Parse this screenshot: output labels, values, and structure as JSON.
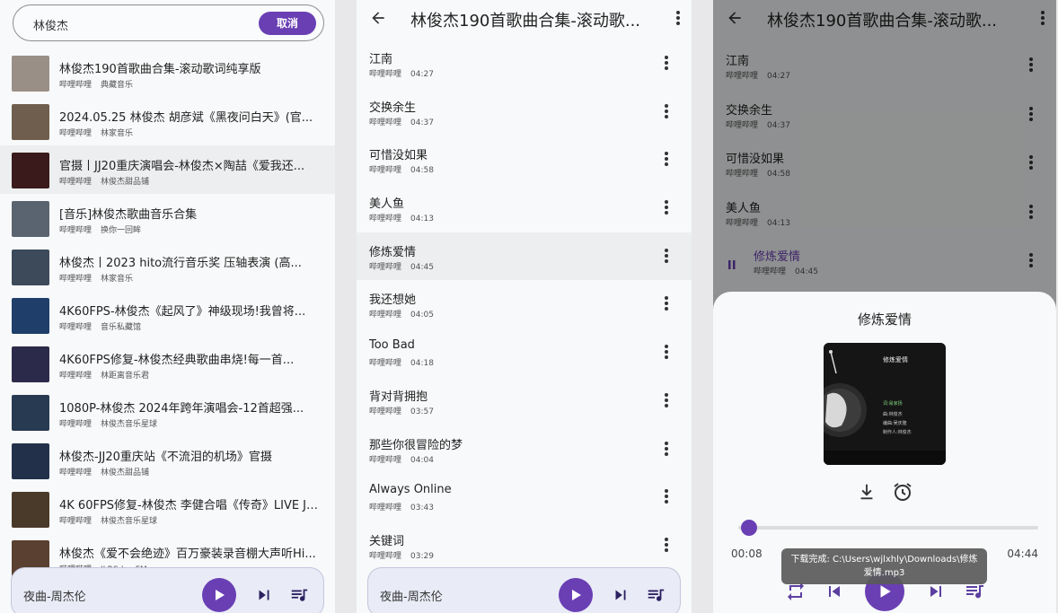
{
  "search": {
    "query": "林俊杰",
    "cancel_label": "取消"
  },
  "results": [
    {
      "title": "林俊杰190首歌曲合集-滚动歌词纯享版",
      "source": "哔哩哔哩",
      "uploader": "典藏音乐",
      "thumb_color": "#9a8f86"
    },
    {
      "title": "2024.05.25 林俊杰 胡彦斌《黑夜问白天》(官...",
      "source": "哔哩哔哩",
      "uploader": "林家音乐",
      "thumb_color": "#6f5e4d"
    },
    {
      "title": "官摄丨JJ20重庆演唱会-林俊杰×陶喆《爱我还...",
      "source": "哔哩哔哩",
      "uploader": "林俊杰甜品铺",
      "thumb_color": "#3a1a1a"
    },
    {
      "title": "[音乐]林俊杰歌曲音乐合集",
      "source": "哔哩哔哩",
      "uploader": "换你一回眸",
      "thumb_color": "#5a6470"
    },
    {
      "title": "林俊杰丨2023 hito流行音乐奖 压轴表演 (高...",
      "source": "哔哩哔哩",
      "uploader": "林家音乐",
      "thumb_color": "#3c4a5a"
    },
    {
      "title": "4K60FPS-林俊杰《起风了》神级现场!我曾将...",
      "source": "哔哩哔哩",
      "uploader": "音乐私藏馆",
      "thumb_color": "#1f3f6a"
    },
    {
      "title": "4K60FPS修复-林俊杰经典歌曲串烧!每一首...",
      "source": "哔哩哔哩",
      "uploader": "林距离音乐君",
      "thumb_color": "#2c2a4a"
    },
    {
      "title": "1080P-林俊杰 2024年跨年演唱会-12首超强...",
      "source": "哔哩哔哩",
      "uploader": "林俊杰音乐星球",
      "thumb_color": "#283a52"
    },
    {
      "title": "林俊杰-JJ20重庆站《不流泪的机场》官摄",
      "source": "哔哩哔哩",
      "uploader": "林俊杰甜品铺",
      "thumb_color": "#22304a"
    },
    {
      "title": "4K 60FPS修复-林俊杰 李健合唱《传奇》LIVE JJ...",
      "source": "哔哩哔哩",
      "uploader": "林俊杰音乐星球",
      "thumb_color": "#4a3a2a"
    },
    {
      "title": "林俊杰《爱不会绝迹》百万豪装录音棚大声听Hi...",
      "source": "哔哩哔哩",
      "uploader": "JLRS-LeoFM",
      "thumb_color": "#5a4030"
    }
  ],
  "mini_player": {
    "title": "夜曲-周杰伦"
  },
  "playlist": {
    "title": "林俊杰190首歌曲合集-滚动歌..."
  },
  "songs": [
    {
      "title": "江南",
      "source": "哔哩哔哩",
      "duration": "04:27"
    },
    {
      "title": "交换余生",
      "source": "哔哩哔哩",
      "duration": "04:37"
    },
    {
      "title": "可惜没如果",
      "source": "哔哩哔哩",
      "duration": "04:58"
    },
    {
      "title": "美人鱼",
      "source": "哔哩哔哩",
      "duration": "04:13"
    },
    {
      "title": "修炼爱情",
      "source": "哔哩哔哩",
      "duration": "04:45"
    },
    {
      "title": "我还想她",
      "source": "哔哩哔哩",
      "duration": "04:05"
    },
    {
      "title": "Too Bad",
      "source": "哔哩哔哩",
      "duration": "04:18"
    },
    {
      "title": "背对背拥抱",
      "source": "哔哩哔哩",
      "duration": "03:57"
    },
    {
      "title": "那些你很冒险的梦",
      "source": "哔哩哔哩",
      "duration": "04:04"
    },
    {
      "title": "Always Online",
      "source": "哔哩哔哩",
      "duration": "03:43"
    },
    {
      "title": "关键词",
      "source": "哔哩哔哩",
      "duration": "03:29"
    }
  ],
  "now_playing": {
    "title": "修炼爱情",
    "cover": {
      "title": "修炼爱情",
      "lines": [
        "词:易家扬",
        "曲:林俊杰",
        "编曲:吴庆隆",
        "制作人:林俊杰"
      ]
    },
    "current_time": "00:08",
    "total_time": "04:44",
    "progress": 0.03,
    "toast": "下载完成: C:\\Users\\wjlxhly\\Downloads\\修炼爱情.mp3"
  },
  "colors": {
    "accent": "#6a3fb4",
    "background": "#f7f9fa"
  }
}
